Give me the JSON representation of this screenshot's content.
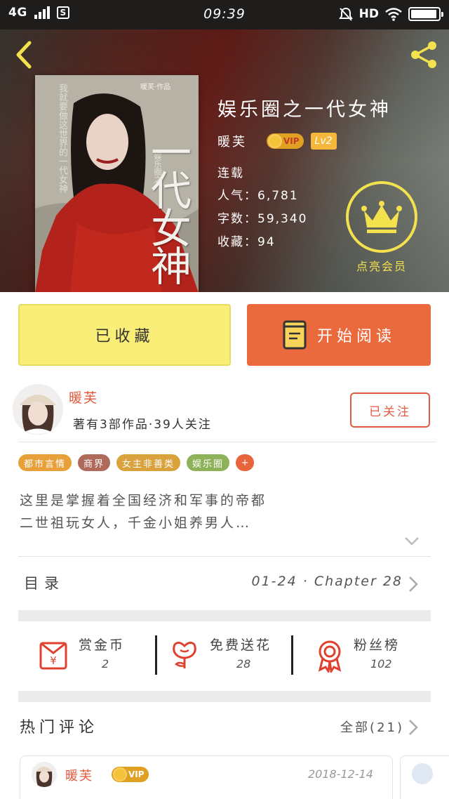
{
  "status_bar": {
    "network": "4G",
    "sim_icon": "S",
    "time": "09:39",
    "hd": "HD"
  },
  "header": {
    "back_icon": "chevron-left-icon",
    "share_icon": "share-icon"
  },
  "book": {
    "title": "娱乐圈之一代女神",
    "author": "暖芙",
    "vip_label": "VIP",
    "level": "Lv2",
    "status": "连载",
    "popularity": "人气：6,781",
    "word_count": "字数：59,340",
    "favorites": "收藏：94",
    "member_label": "点亮会员",
    "cover": {
      "title": "一代女神",
      "mini_text": "暖芙·作品",
      "vertical_text": "我就要做这世界的一代女神",
      "vertical_text2": "娱乐圈之"
    }
  },
  "actions": {
    "collected_label": "已收藏",
    "read_label": "开始阅读"
  },
  "author_card": {
    "name": "暖芙",
    "meta": "著有3部作品·39人关注",
    "follow_label": "已关注"
  },
  "tags": [
    {
      "label": "都市言情",
      "color": "#e8a13a"
    },
    {
      "label": "商界",
      "color": "#b06a5c"
    },
    {
      "label": "女主非善类",
      "color": "#d9a23c"
    },
    {
      "label": "娱乐圈",
      "color": "#8db25a"
    }
  ],
  "tag_add": "+",
  "description": {
    "line1": "这里是掌握着全国经济和军事的帝都",
    "line2": "二世祖玩女人，千金小姐养男人…"
  },
  "catalog": {
    "label": "目录",
    "latest": "01-24 · Chapter 28"
  },
  "rewards": [
    {
      "label": "赏金币",
      "value": "2",
      "icon": "red-envelope-icon"
    },
    {
      "label": "免费送花",
      "value": "28",
      "icon": "flower-icon"
    },
    {
      "label": "粉丝榜",
      "value": "102",
      "icon": "medal-icon"
    }
  ],
  "comments": {
    "title": "热门评论",
    "all_label": "全部(21)",
    "items": [
      {
        "user": "暖芙",
        "vip_label": "VIP",
        "date": "2018-12-14"
      }
    ]
  },
  "colors": {
    "accent_orange": "#ea6a3e",
    "collected_yellow": "#f9ef78",
    "author_red": "#e4583c",
    "member_gold": "#f3e24d"
  }
}
